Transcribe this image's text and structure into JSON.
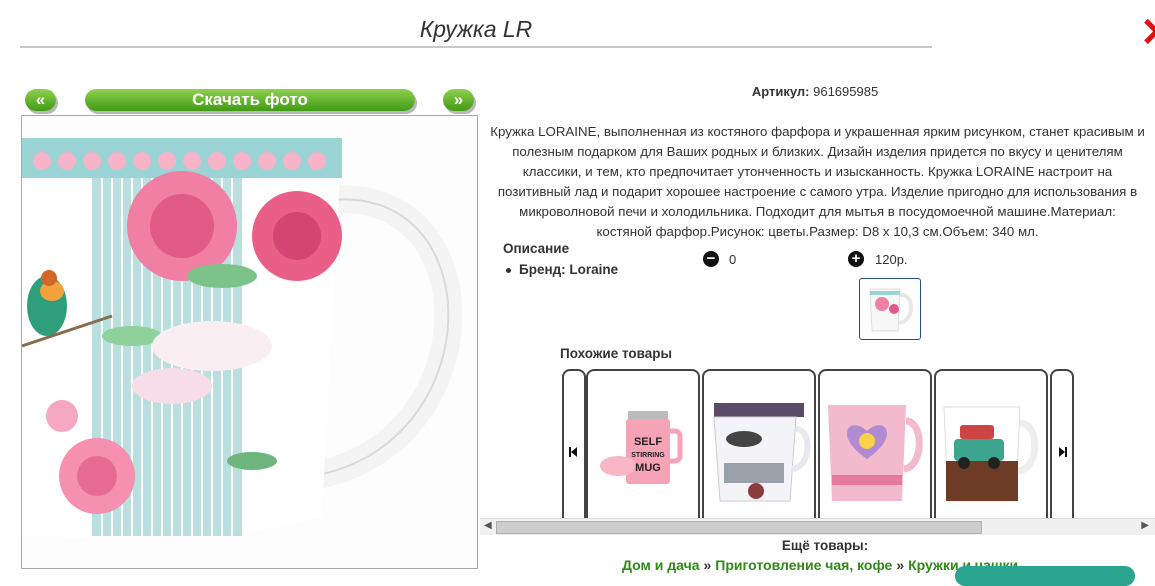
{
  "product": {
    "title": "Кружка LR",
    "article_label": "Артикул:",
    "article_value": "961695985",
    "description": "Кружка LORAINE, выполненная из костяного фарфора и украшенная ярким рисунком, станет красивым и полезным подарком для Ваших родных и близких. Дизайн изделия придется по вкусу и ценителям классики, и тем, кто предпочитает утонченность и изысканность. Кружка LORAINE настроит на позитивный лад и подарит хорошее настроение с самого утра. Изделие пригодно для использования в микроволновой печи и холодильника. Подходит для мытья в посудомоечной машине.Материал: костяной фарфор.Рисунок: цветы.Размер: D8 x 10,3 см.Объем: 340 мл.",
    "section_label": "Описание",
    "brand_label": "Бренд: Loraine"
  },
  "photo_nav": {
    "prev_label": "«",
    "download_label": "Скачать фото",
    "next_label": "»"
  },
  "quantity": {
    "minus_value": "0",
    "plus_value": "120р."
  },
  "similar": {
    "title": "Похожие товары",
    "items": [
      {
        "name": "self-stirring-mug",
        "text": "SELF STIRRING MUG"
      },
      {
        "name": "cafe-car-mug"
      },
      {
        "name": "heart-mug"
      },
      {
        "name": "cafe-mug"
      }
    ]
  },
  "footer": {
    "more_label": "Ещё товары:",
    "crumbs": [
      "Дом и дача",
      "Приготовление чая, кофе",
      "Кружки и чашки"
    ],
    "separator": "»"
  },
  "colors": {
    "accent_green": "#3f9a14",
    "close_red": "#e01010",
    "link_green": "#2e8b14"
  },
  "icons": [
    "close-icon",
    "minus-icon",
    "plus-icon",
    "first-arrow-icon",
    "next-arrow-icon"
  ]
}
